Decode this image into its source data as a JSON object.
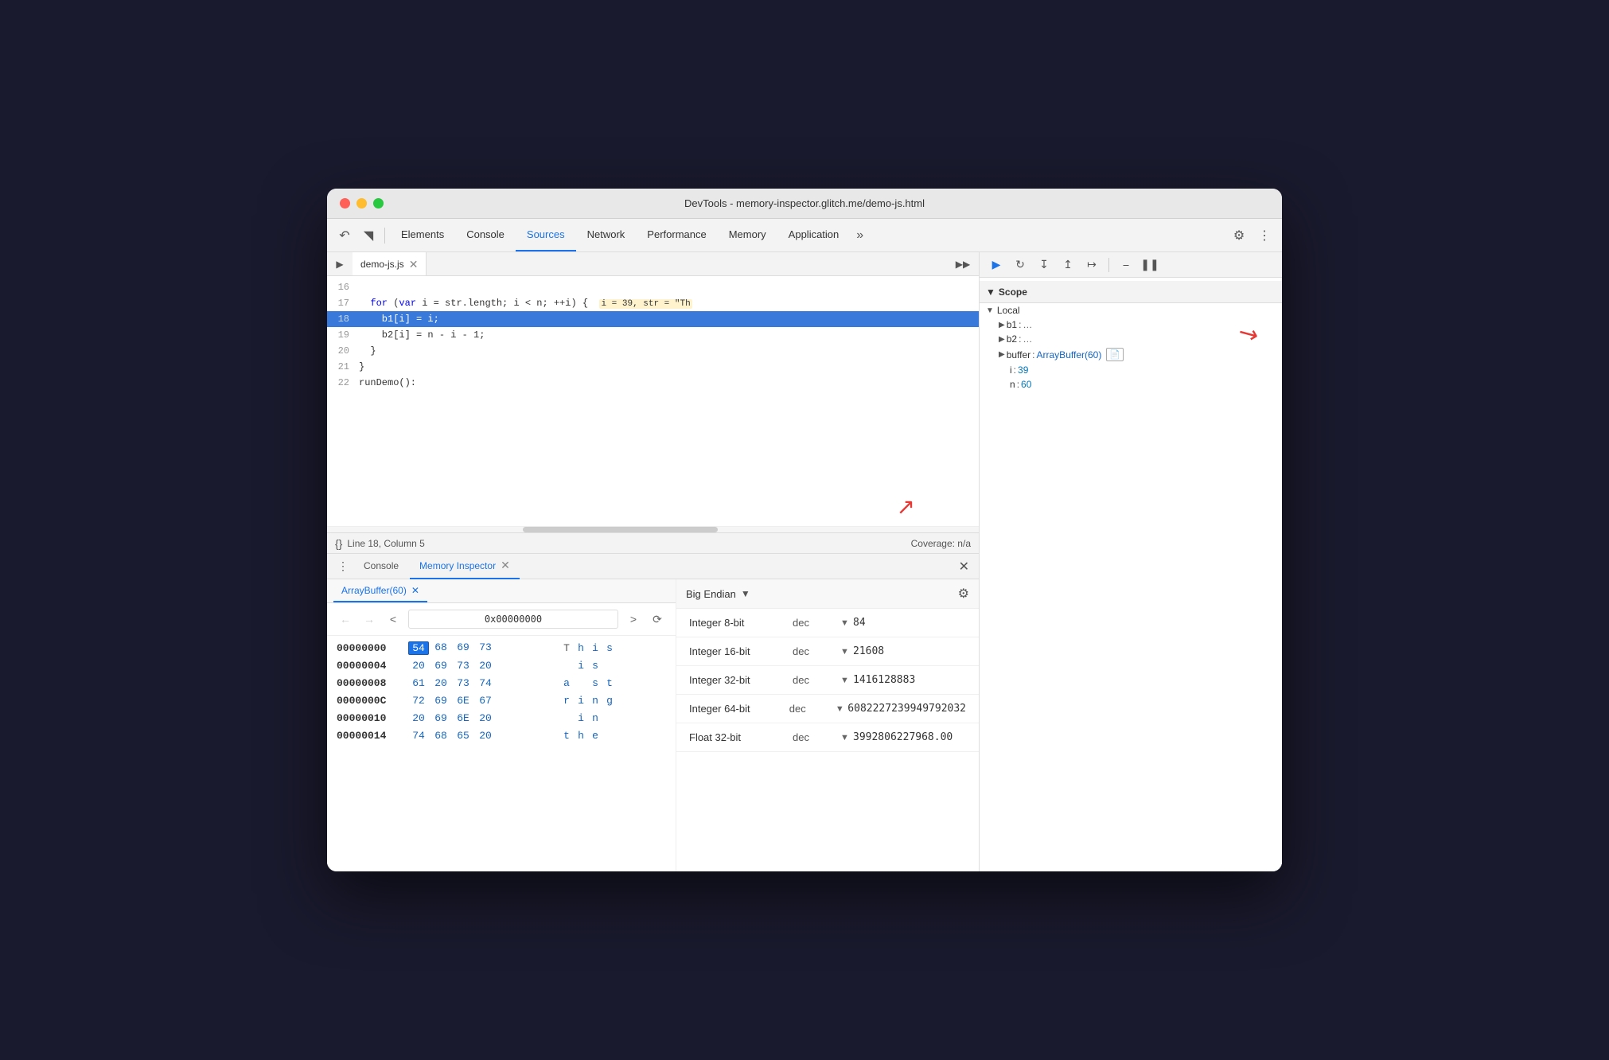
{
  "window": {
    "title": "DevTools - memory-inspector.glitch.me/demo-js.html"
  },
  "devtools": {
    "tabs": [
      {
        "label": "Elements",
        "active": false
      },
      {
        "label": "Console",
        "active": false
      },
      {
        "label": "Sources",
        "active": true
      },
      {
        "label": "Network",
        "active": false
      },
      {
        "label": "Performance",
        "active": false
      },
      {
        "label": "Memory",
        "active": false
      },
      {
        "label": "Application",
        "active": false
      }
    ]
  },
  "source": {
    "filename": "demo-js.js",
    "lines": [
      {
        "num": "16",
        "text": ""
      },
      {
        "num": "17",
        "text": "  for (var i = str.length; i < n; ++i) {",
        "inline": "  i = 39, str = \"Th"
      },
      {
        "num": "18",
        "text": "    b1[i] = i;",
        "highlighted": true
      },
      {
        "num": "19",
        "text": "    b2[i] = n - i - 1;"
      },
      {
        "num": "20",
        "text": "  }"
      },
      {
        "num": "21",
        "text": "}"
      },
      {
        "num": "22",
        "text": "runDemo():"
      }
    ],
    "status": {
      "left": "Line 18, Column 5",
      "right": "Coverage: n/a"
    }
  },
  "bottom_tabs": [
    {
      "label": "Console",
      "active": false
    },
    {
      "label": "Memory Inspector",
      "active": true
    }
  ],
  "memory_inspector": {
    "buffer_tab": "ArrayBuffer(60)",
    "address": "0x00000000",
    "rows": [
      {
        "addr": "00000000",
        "bytes": [
          "54",
          "68",
          "69",
          "73"
        ],
        "chars": [
          "T",
          "h",
          "i",
          "s"
        ],
        "selected_byte": 0,
        "selected_char": 0
      },
      {
        "addr": "00000004",
        "bytes": [
          "20",
          "69",
          "73",
          "20"
        ],
        "chars": [
          " ",
          "i",
          "s",
          " "
        ]
      },
      {
        "addr": "00000008",
        "bytes": [
          "61",
          "20",
          "73",
          "74"
        ],
        "chars": [
          "a",
          " ",
          "s",
          "t"
        ]
      },
      {
        "addr": "0000000C",
        "bytes": [
          "72",
          "69",
          "6E",
          "67"
        ],
        "chars": [
          "r",
          "i",
          "n",
          "g"
        ]
      },
      {
        "addr": "00000010",
        "bytes": [
          "20",
          "69",
          "6E",
          "20"
        ],
        "chars": [
          " ",
          "i",
          "n",
          " "
        ]
      },
      {
        "addr": "00000014",
        "bytes": [
          "74",
          "68",
          "65",
          "20"
        ],
        "chars": [
          "t",
          "h",
          "e",
          " "
        ]
      }
    ],
    "endian": "Big Endian",
    "inspector_rows": [
      {
        "label": "Integer 8-bit",
        "format": "dec",
        "value": "84"
      },
      {
        "label": "Integer 16-bit",
        "format": "dec",
        "value": "21608"
      },
      {
        "label": "Integer 32-bit",
        "format": "dec",
        "value": "1416128883"
      },
      {
        "label": "Integer 64-bit",
        "format": "dec",
        "value": "6082227239949792032"
      },
      {
        "label": "Float 32-bit",
        "format": "dec",
        "value": "3992806227968.00"
      }
    ]
  },
  "scope": {
    "title": "Scope",
    "sections": [
      {
        "title": "Local",
        "items": [
          {
            "key": "b1",
            "val": "…",
            "expandable": true
          },
          {
            "key": "b2",
            "val": "…",
            "expandable": true
          },
          {
            "key": "buffer",
            "val": "ArrayBuffer(60)",
            "expandable": true,
            "has_icon": true
          },
          {
            "key": "i",
            "val": "39"
          },
          {
            "key": "n",
            "val": "60"
          }
        ]
      }
    ]
  }
}
